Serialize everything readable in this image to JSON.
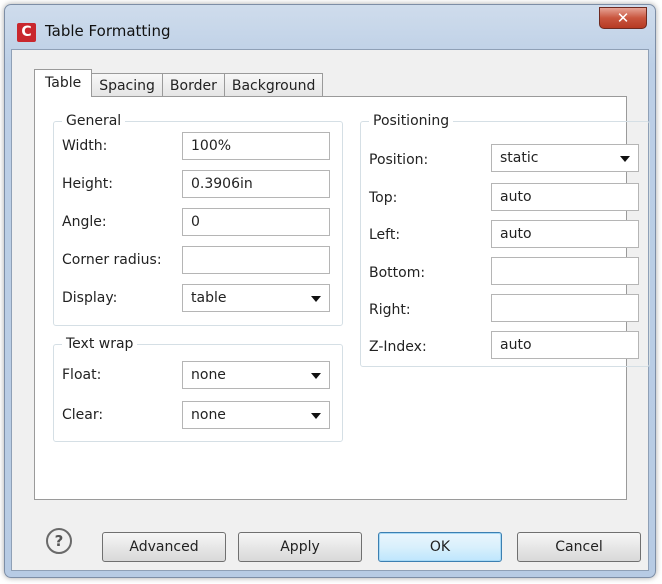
{
  "window": {
    "title": "Table Formatting",
    "app_icon_letter": "C",
    "close_glyph": "✕"
  },
  "tabs": [
    {
      "label": "Table",
      "active": true
    },
    {
      "label": "Spacing",
      "active": false
    },
    {
      "label": "Border",
      "active": false
    },
    {
      "label": "Background",
      "active": false
    }
  ],
  "general": {
    "title": "General",
    "width": {
      "label": "Width:",
      "value": "100%"
    },
    "height": {
      "label": "Height:",
      "value": "0.3906in"
    },
    "angle": {
      "label": "Angle:",
      "value": "0"
    },
    "corner_radius": {
      "label": "Corner radius:",
      "value": ""
    },
    "display": {
      "label": "Display:",
      "value": "table"
    }
  },
  "text_wrap": {
    "title": "Text wrap",
    "float": {
      "label": "Float:",
      "value": "none"
    },
    "clear": {
      "label": "Clear:",
      "value": "none"
    }
  },
  "positioning": {
    "title": "Positioning",
    "position": {
      "label": "Position:",
      "value": "static"
    },
    "top": {
      "label": "Top:",
      "value": "auto"
    },
    "left": {
      "label": "Left:",
      "value": "auto"
    },
    "bottom": {
      "label": "Bottom:",
      "value": ""
    },
    "right": {
      "label": "Right:",
      "value": ""
    },
    "z_index": {
      "label": "Z-Index:",
      "value": "auto"
    }
  },
  "footer": {
    "help_glyph": "?",
    "advanced": "Advanced",
    "apply": "Apply",
    "ok": "OK",
    "cancel": "Cancel"
  },
  "colors": {
    "app_icon": "#c9272e",
    "close_button": "#c9553e",
    "ok_button": "#bee6fd"
  }
}
